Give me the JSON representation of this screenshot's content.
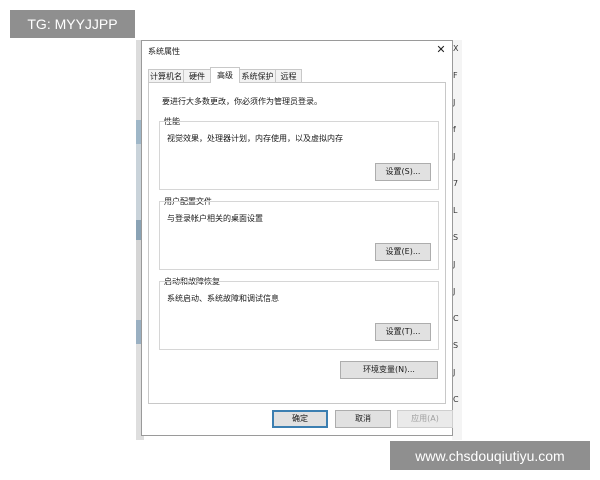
{
  "watermarks": {
    "top_left": "TG: MYYJJPP",
    "bottom_right": "www.chsdouqiutiyu.com"
  },
  "dialog": {
    "title": "系统属性",
    "close_glyph": "✕",
    "tabs": [
      {
        "label": "计算机名",
        "active": false
      },
      {
        "label": "硬件",
        "active": false
      },
      {
        "label": "高级",
        "active": true
      },
      {
        "label": "系统保护",
        "active": false
      },
      {
        "label": "远程",
        "active": false
      }
    ],
    "admin_note": "要进行大多数更改，你必须作为管理员登录。",
    "groups": [
      {
        "label": "性能",
        "description": "视觉效果，处理器计划，内存使用，以及虚拟内存",
        "button": "设置(S)..."
      },
      {
        "label": "用户配置文件",
        "description": "与登录帐户相关的桌面设置",
        "button": "设置(E)..."
      },
      {
        "label": "启动和故障恢复",
        "description": "系统启动、系统故障和调试信息",
        "button": "设置(T)..."
      }
    ],
    "env_button": "环境变量(N)...",
    "buttons": {
      "ok": "确定",
      "cancel": "取消",
      "apply": "应用(A)"
    }
  },
  "background_right_glyphs": [
    "X",
    "F",
    "J",
    "f",
    "J",
    "7",
    "L",
    "S",
    "J",
    "J",
    "C",
    "S",
    "J",
    "C"
  ]
}
